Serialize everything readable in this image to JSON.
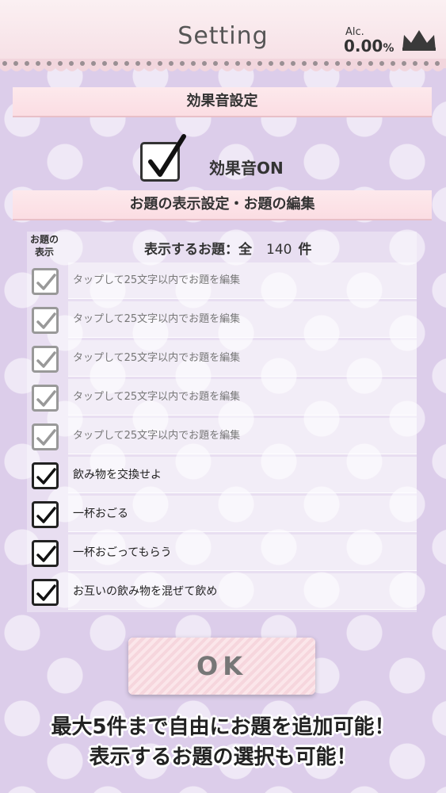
{
  "header": {
    "title": "Setting",
    "alc_label": "Alc.",
    "alc_value": "0.00",
    "alc_unit": "%"
  },
  "sound": {
    "section_title": "効果音設定",
    "toggle_label": "効果音ON",
    "checked": true
  },
  "topics": {
    "section_title": "お題の表示設定・お題の編集",
    "column_header_line1": "お題の",
    "column_header_line2": "表示",
    "count_prefix": "表示するお題：全",
    "count": "140",
    "count_suffix": "件",
    "items": [
      {
        "label": "タップして25文字以内でお題を編集",
        "editable_placeholder": true
      },
      {
        "label": "タップして25文字以内でお題を編集",
        "editable_placeholder": true
      },
      {
        "label": "タップして25文字以内でお題を編集",
        "editable_placeholder": true
      },
      {
        "label": "タップして25文字以内でお題を編集",
        "editable_placeholder": true
      },
      {
        "label": "タップして25文字以内でお題を編集",
        "editable_placeholder": true
      },
      {
        "label": "飲み物を交換せよ",
        "editable_placeholder": false
      },
      {
        "label": "一杯おごる",
        "editable_placeholder": false
      },
      {
        "label": "一杯おごってもらう",
        "editable_placeholder": false
      },
      {
        "label": "お互いの飲み物を混ぜて飲め",
        "editable_placeholder": false
      }
    ]
  },
  "ok_label": "OK",
  "promo": {
    "line1": "最大5件まで自由にお題を追加可能！",
    "line2": "表示するお題の選択も可能！"
  },
  "colors": {
    "background": "#dccdea",
    "header": "#f6dfe5",
    "section_band": "#fbdde3"
  }
}
